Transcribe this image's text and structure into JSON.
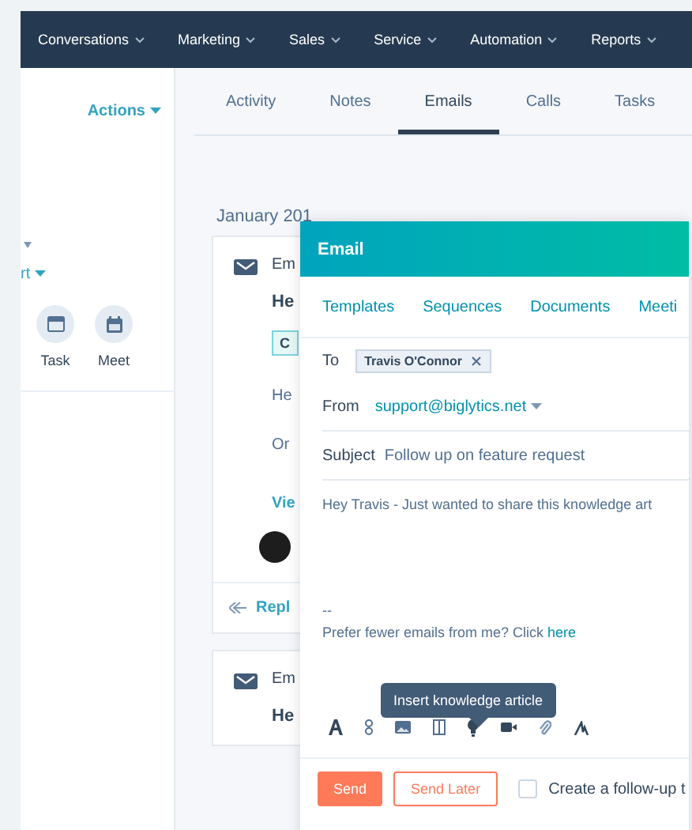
{
  "nav": {
    "items": [
      {
        "label": "Conversations"
      },
      {
        "label": "Marketing"
      },
      {
        "label": "Sales"
      },
      {
        "label": "Service"
      },
      {
        "label": "Automation"
      },
      {
        "label": "Reports"
      }
    ]
  },
  "sidebar": {
    "actions": "Actions",
    "partial_label": "rt",
    "activities": [
      {
        "kind": "task",
        "label": "Task"
      },
      {
        "kind": "meeting",
        "label": "Meet"
      }
    ]
  },
  "tabs": [
    {
      "label": "Activity",
      "selected": false
    },
    {
      "label": "Notes",
      "selected": false
    },
    {
      "label": "Emails",
      "selected": true
    },
    {
      "label": "Calls",
      "selected": false
    },
    {
      "label": "Tasks",
      "selected": false
    }
  ],
  "timeline": {
    "month": "January 201",
    "cards": [
      {
        "title": "Em",
        "subject": "He",
        "chip": "C",
        "lines": [
          "He",
          "Or"
        ],
        "link": "Vie",
        "reply": "Repl"
      },
      {
        "title": "Em",
        "subject": "He"
      }
    ]
  },
  "email": {
    "title": "Email",
    "tabs": [
      "Templates",
      "Sequences",
      "Documents",
      "Meeti"
    ],
    "to_label": "To",
    "recipient": "Travis O'Connor",
    "from_label": "From",
    "from_address": "support@biglytics.net",
    "subject_label": "Subject",
    "subject": "Follow up on feature request",
    "body": "Hey Travis - Just wanted to share this knowledge art",
    "separator": "--",
    "footer_text": "Prefer fewer emails from me? Click",
    "footer_link": "here",
    "tooltip": "Insert knowledge article",
    "send": "Send",
    "send_later": "Send Later",
    "follow_up": {
      "label": "Create a follow-up t",
      "checked": false
    }
  }
}
